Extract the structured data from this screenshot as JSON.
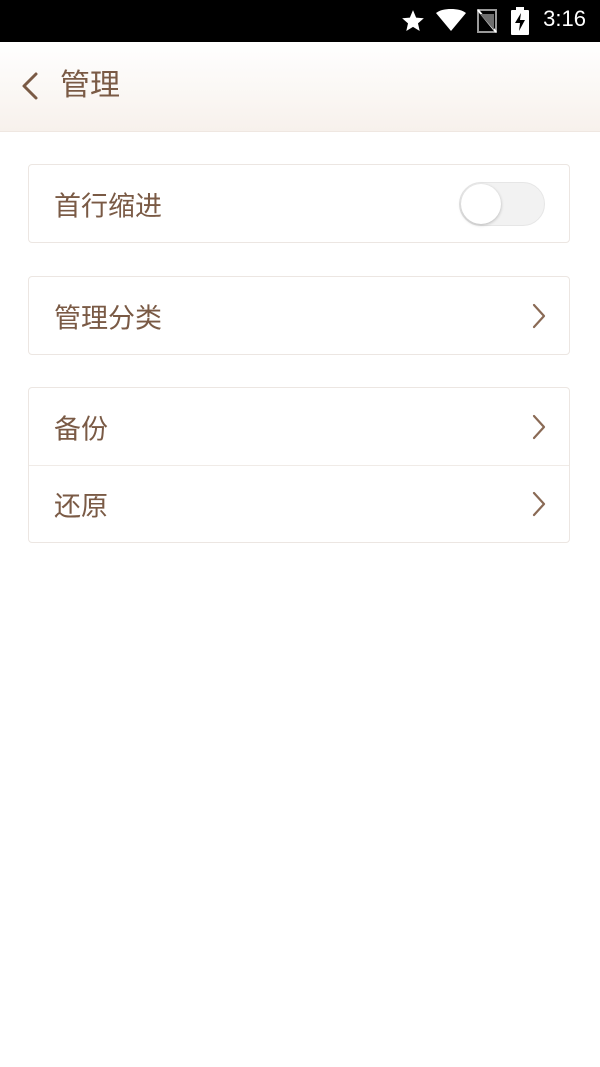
{
  "status_bar": {
    "time": "3:16",
    "icons": [
      "star-icon",
      "wifi-icon",
      "no-sim-icon",
      "battery-charging-icon"
    ]
  },
  "header": {
    "title": "管理",
    "back_icon": "chevron-left-icon"
  },
  "settings": {
    "indent": {
      "label": "首行缩进",
      "enabled": false
    },
    "category": {
      "label": "管理分类"
    },
    "backup": {
      "label": "备份"
    },
    "restore": {
      "label": "还原"
    }
  },
  "colors": {
    "text": "#7a5a45",
    "header_bg": "#f7f1ec",
    "chevron": "#8a6a55"
  }
}
